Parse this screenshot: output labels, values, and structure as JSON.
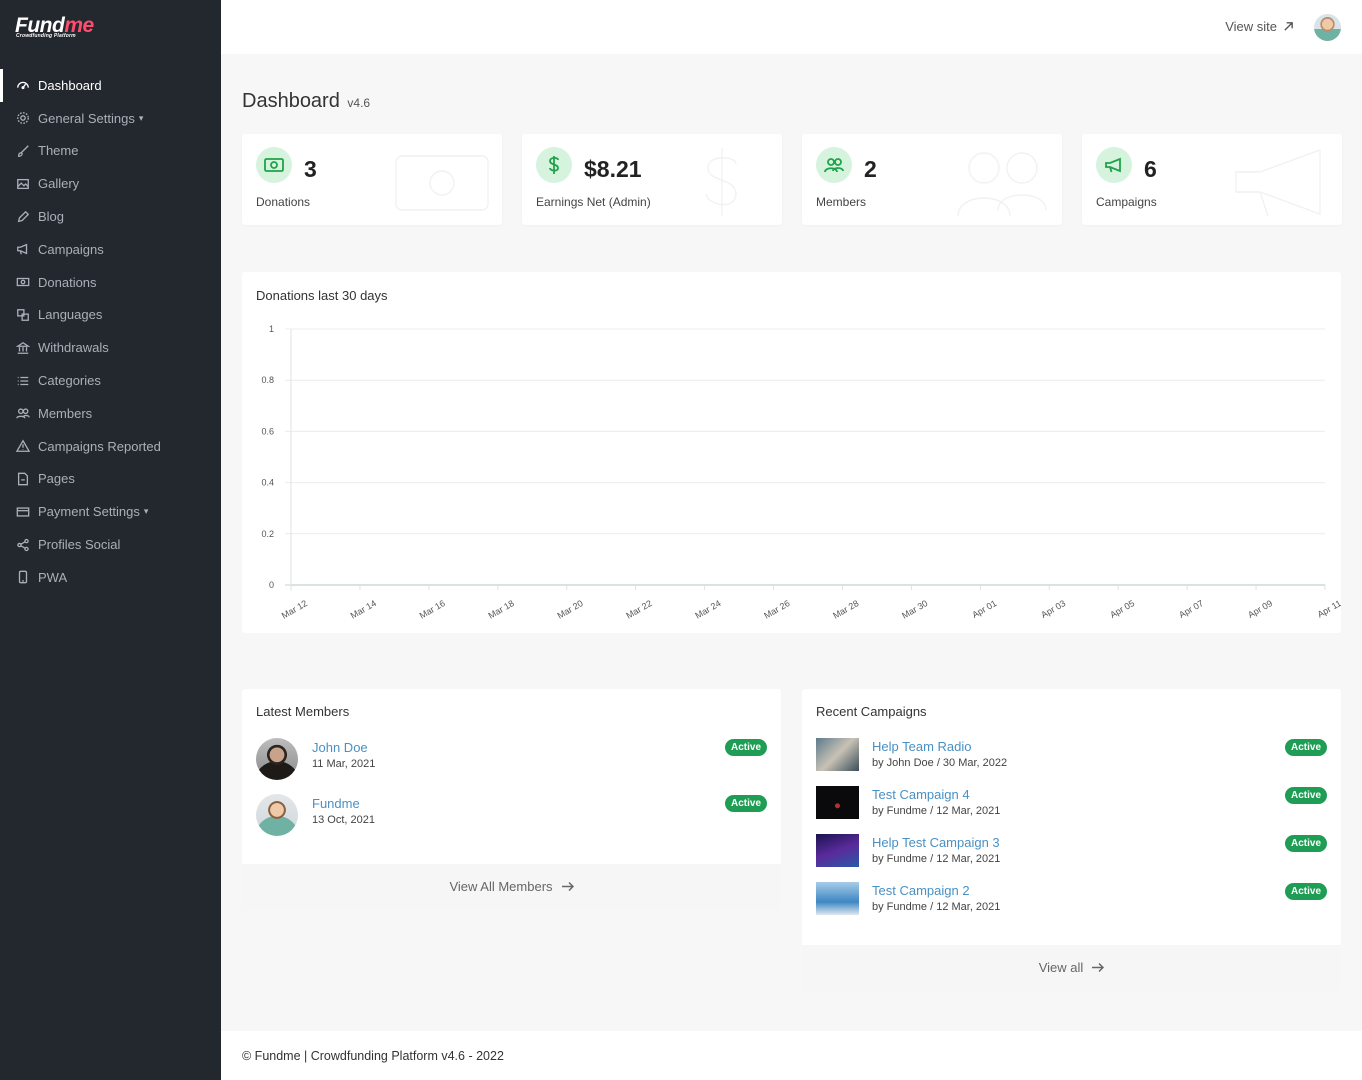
{
  "brand": {
    "name_a": "Fund",
    "name_b": "me",
    "tagline": "Crowdfunding Platform",
    "accent": "#ff4d6d"
  },
  "sidebar": {
    "items": [
      {
        "label": "Dashboard",
        "icon": "dashboard-icon",
        "active": true
      },
      {
        "label": "General Settings",
        "icon": "gear-icon",
        "caret": "▾"
      },
      {
        "label": "Theme",
        "icon": "brush-icon"
      },
      {
        "label": "Gallery",
        "icon": "image-icon"
      },
      {
        "label": "Blog",
        "icon": "pencil-icon"
      },
      {
        "label": "Campaigns",
        "icon": "megaphone-icon"
      },
      {
        "label": "Donations",
        "icon": "cash-icon"
      },
      {
        "label": "Languages",
        "icon": "translate-icon"
      },
      {
        "label": "Withdrawals",
        "icon": "bank-icon"
      },
      {
        "label": "Categories",
        "icon": "list-icon"
      },
      {
        "label": "Members",
        "icon": "people-icon"
      },
      {
        "label": "Campaigns Reported",
        "icon": "warning-icon"
      },
      {
        "label": "Pages",
        "icon": "file-icon"
      },
      {
        "label": "Payment Settings",
        "icon": "credit-card-icon",
        "caret": "▾"
      },
      {
        "label": "Profiles Social",
        "icon": "share-icon"
      },
      {
        "label": "PWA",
        "icon": "phone-icon"
      }
    ]
  },
  "topbar": {
    "view_site": "View site"
  },
  "page": {
    "title": "Dashboard",
    "version": "v4.6"
  },
  "stats": [
    {
      "value": "3",
      "label": "Donations",
      "icon": "cash-icon"
    },
    {
      "value": "$8.21",
      "label": "Earnings Net (Admin)",
      "icon": "dollar-icon"
    },
    {
      "value": "2",
      "label": "Members",
      "icon": "people-icon"
    },
    {
      "value": "6",
      "label": "Campaigns",
      "icon": "megaphone-icon"
    }
  ],
  "chart_data": {
    "type": "line",
    "title": "Donations last 30 days",
    "x": [
      "Mar 12",
      "Mar 14",
      "Mar 16",
      "Mar 18",
      "Mar 20",
      "Mar 22",
      "Mar 24",
      "Mar 26",
      "Mar 28",
      "Mar 30",
      "Apr 01",
      "Apr 03",
      "Apr 05",
      "Apr 07",
      "Apr 09",
      "Apr 11"
    ],
    "series": [
      {
        "values": [
          0,
          0,
          0,
          0,
          0,
          0,
          0,
          0,
          0,
          0,
          0,
          0,
          0,
          0,
          0,
          0
        ]
      }
    ],
    "yticks": [
      "0",
      "0.2",
      "0.4",
      "0.6",
      "0.8",
      "1"
    ],
    "ylim": [
      0,
      1
    ],
    "grid": true
  },
  "latest_members": {
    "title": "Latest Members",
    "items": [
      {
        "name": "John Doe",
        "date": "11 Mar, 2021",
        "status": "Active"
      },
      {
        "name": "Fundme",
        "date": "13 Oct, 2021",
        "status": "Active"
      }
    ],
    "view_all": "View All Members"
  },
  "recent_campaigns": {
    "title": "Recent Campaigns",
    "items": [
      {
        "name": "Help Team Radio",
        "meta": "by John Doe / 30 Mar, 2022",
        "status": "Active"
      },
      {
        "name": "Test Campaign 4",
        "meta": "by Fundme / 12 Mar, 2021",
        "status": "Active"
      },
      {
        "name": "Help Test Campaign 3",
        "meta": "by Fundme / 12 Mar, 2021",
        "status": "Active"
      },
      {
        "name": "Test Campaign 2",
        "meta": "by Fundme / 12 Mar, 2021",
        "status": "Active"
      }
    ],
    "view_all": "View all"
  },
  "footer": {
    "text": "© Fundme | Crowdfunding Platform v4.6 - 2022"
  },
  "colors": {
    "sidebar": "#23282e",
    "badge": "#1f9d55",
    "link": "#4a90c2",
    "icon_green": "#1fa34a"
  }
}
